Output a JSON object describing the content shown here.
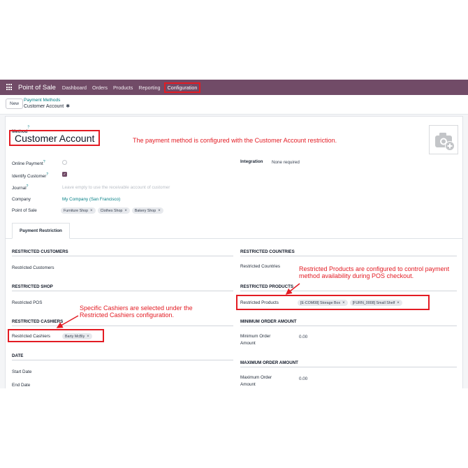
{
  "nav": {
    "app_name": "Point of Sale",
    "items": [
      "Dashboard",
      "Orders",
      "Products",
      "Reporting"
    ],
    "active_item": "Configuration"
  },
  "control": {
    "new_label": "New",
    "breadcrumb_parent": "Payment Methods",
    "breadcrumb_current": "Customer Account"
  },
  "form": {
    "method_label": "Method",
    "method_name": "Customer Account",
    "online_payment_label": "Online Payment",
    "identify_customer_label": "Identify Customer",
    "journal_label": "Journal",
    "journal_placeholder": "Leave empty to use the receivable account of customer",
    "company_label": "Company",
    "company_value": "My Company (San Francisco)",
    "pos_label": "Point of Sale",
    "pos_tags": [
      "Furniture Shop",
      "Clothes Shop",
      "Bakery Shop"
    ],
    "integration_label": "Integration",
    "integration_value": "None required",
    "help_marker": "?"
  },
  "tab": {
    "label": "Payment Restriction"
  },
  "restrictions": {
    "customers_heading": "RESTRICTED CUSTOMERS",
    "customers_label": "Restricted Customers",
    "shop_heading": "RESTRICTED SHOP",
    "pos_label": "Restricted POS",
    "cashiers_heading": "RESTRICTED CASHIERS",
    "cashiers_label": "Restricted Cashiers",
    "cashier_tags": [
      "Barty McBly"
    ],
    "date_heading": "DATE",
    "start_date_label": "Start Date",
    "end_date_label": "End Date",
    "countries_heading": "RESTRICTED COUNTRIES",
    "countries_label": "Restricted Countries",
    "products_heading": "RESTRICTED PRODUCTS",
    "products_label": "Restricted Products",
    "product_tags": [
      "[E-COM08] Storage Box",
      "[FURN_0008] Small Shelf"
    ],
    "min_heading": "MINIMUM ORDER AMOUNT",
    "min_label_1": "Minimum Order",
    "min_label_2": "Amount",
    "min_value": "0.00",
    "max_heading": "MAXIMUM ORDER AMOUNT",
    "max_label_1": "Maximum Order",
    "max_label_2": "Amount",
    "max_value": "0.00"
  },
  "annotations": {
    "method": "The payment method is configured with the Customer Account restriction.",
    "products_1": "Restricted Products are configured to control payment",
    "products_2": "method availability during POS checkout.",
    "cashiers_1": "Specific Cashiers are selected under the",
    "cashiers_2": "Restricted Cashiers configuration."
  },
  "colors": {
    "navbar": "#714b67",
    "annotation": "#e31b23",
    "link": "#017e84"
  }
}
